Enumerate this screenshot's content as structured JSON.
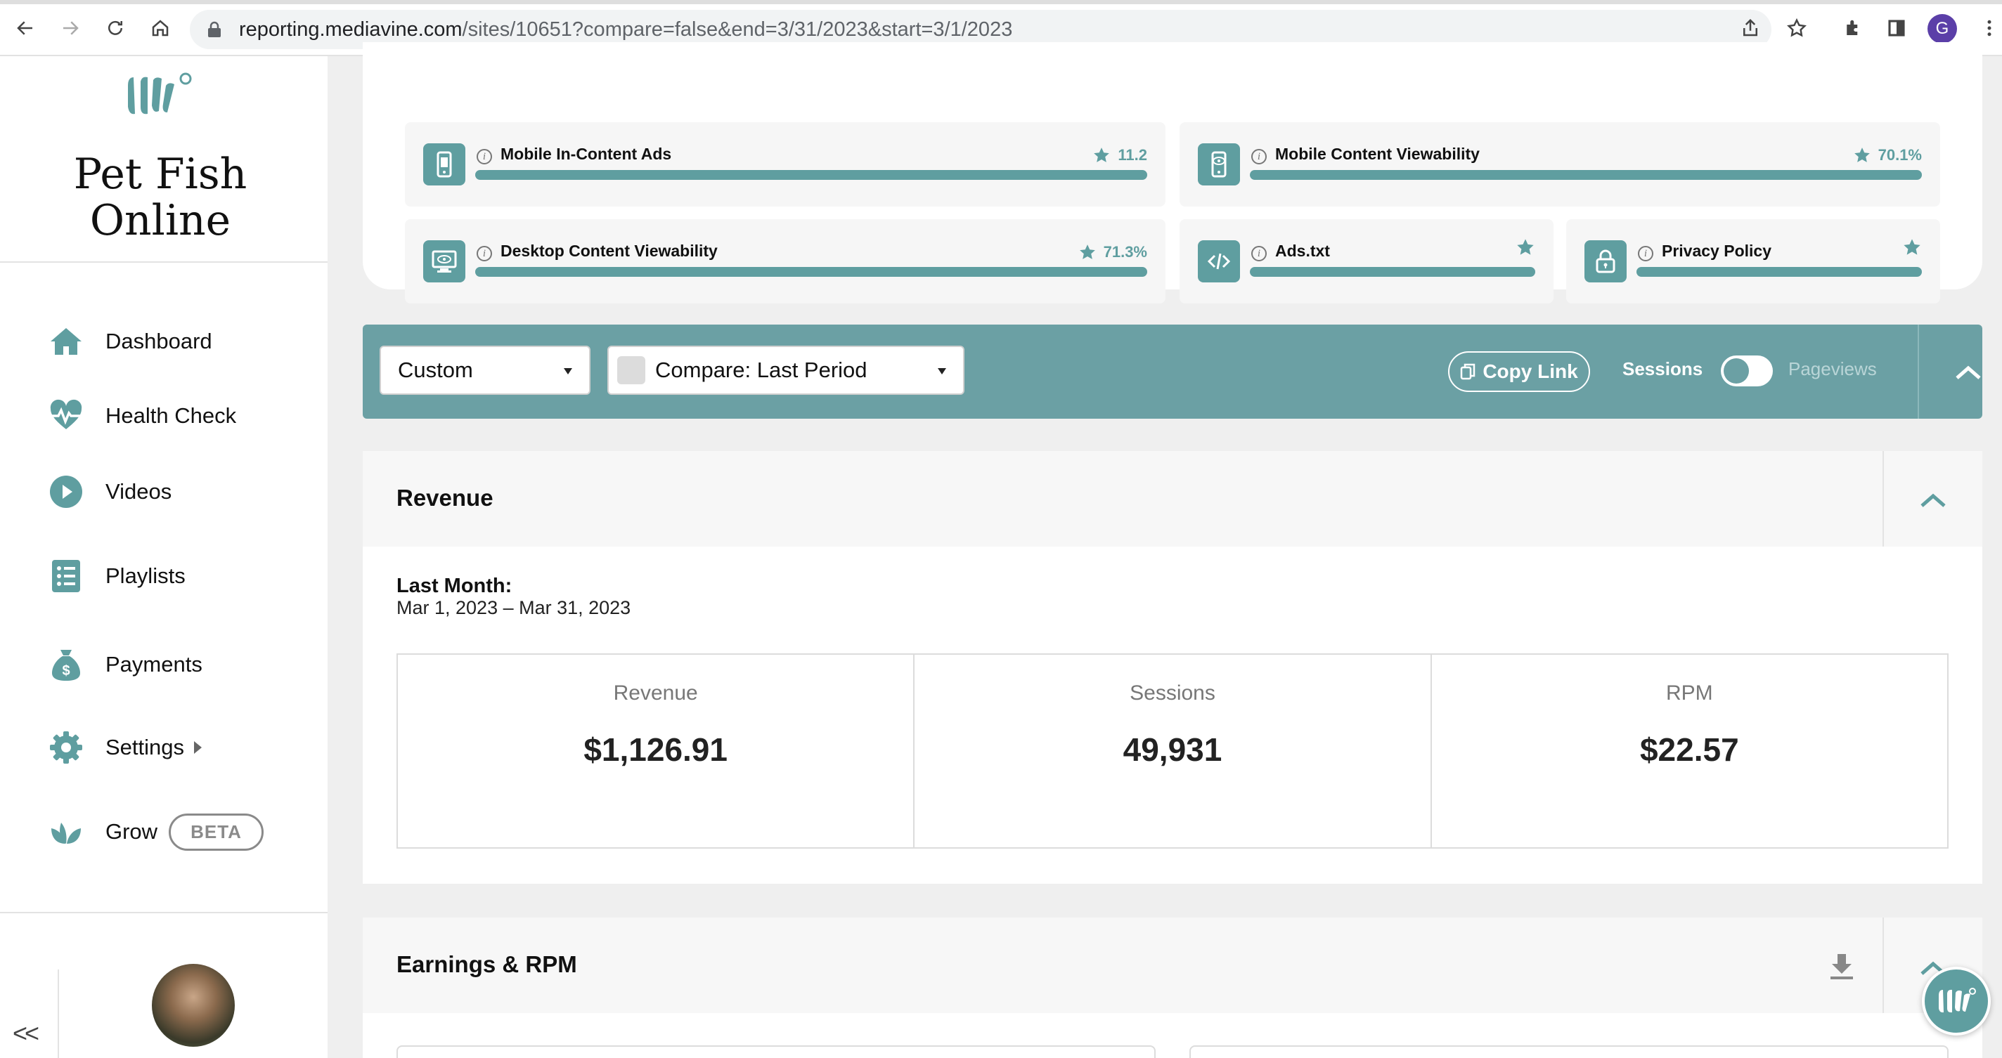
{
  "browser": {
    "url_host": "reporting.mediavine.com",
    "url_path": "/sites/10651?compare=false&end=3/31/2023&start=3/1/2023",
    "profile_initial": "G"
  },
  "sidebar": {
    "site_name_line1": "Pet Fish",
    "site_name_line2": "Online",
    "items": [
      {
        "label": "Dashboard",
        "icon": "home-icon"
      },
      {
        "label": "Health Check",
        "icon": "heartbeat-icon"
      },
      {
        "label": "Videos",
        "icon": "play-circle-icon"
      },
      {
        "label": "Playlists",
        "icon": "list-icon"
      },
      {
        "label": "Payments",
        "icon": "money-bag-icon"
      },
      {
        "label": "Settings",
        "icon": "gear-icon"
      },
      {
        "label": "Grow",
        "icon": "leaf-icon",
        "badge": "BETA"
      }
    ],
    "collapse_label": "<<"
  },
  "health_check": {
    "items": [
      {
        "label": "Mobile In-Content Ads",
        "score": "11.2",
        "icon": "mobile-icon"
      },
      {
        "label": "Mobile Content Viewability",
        "score": "70.1%",
        "icon": "mobile-eye-icon"
      },
      {
        "label": "Desktop Content Viewability",
        "score": "71.3%",
        "icon": "desktop-eye-icon"
      },
      {
        "label": "Ads.txt",
        "score": "",
        "icon": "code-icon"
      },
      {
        "label": "Privacy Policy",
        "score": "",
        "icon": "lock-icon"
      }
    ],
    "bar_fill": 1.0
  },
  "filters": {
    "date_range": "Custom",
    "compare": "Compare: Last Period",
    "copy_link": "Copy Link",
    "toggle_left": "Sessions",
    "toggle_right": "Pageviews",
    "toggle_state": "Sessions"
  },
  "revenue": {
    "title": "Revenue",
    "period_title": "Last Month:",
    "period_range": "Mar 1, 2023 – Mar 31, 2023",
    "stats": [
      {
        "label": "Revenue",
        "value": "$1,126.91"
      },
      {
        "label": "Sessions",
        "value": "49,931"
      },
      {
        "label": "RPM",
        "value": "$22.57"
      }
    ]
  },
  "earnings": {
    "title": "Earnings & RPM"
  },
  "colors": {
    "accent": "#5f9ea0",
    "filter_bar": "#6ba0a4"
  }
}
